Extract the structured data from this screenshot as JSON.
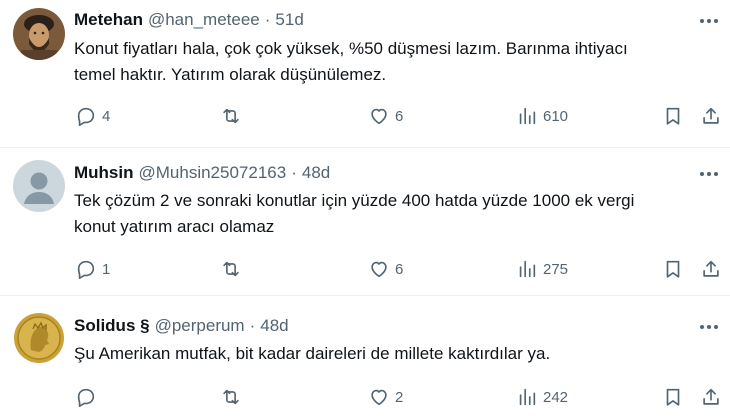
{
  "tweets": [
    {
      "name": "Metehan",
      "handle": "@han_meteee",
      "separator": "·",
      "time": "51d",
      "text_lines": [
        "Konut fiyatları hala, çok çok yüksek, %50 düşmesi lazım. Barınma ihtiyacı",
        "temel haktır. Yatırım olarak düşünülemez."
      ],
      "replies": "4",
      "retweets": "",
      "likes": "6",
      "views": "610",
      "avatar_icon": "historical-portrait-avatar"
    },
    {
      "name": "Muhsin",
      "handle": "@Muhsin25072163",
      "separator": "·",
      "time": "48d",
      "text_lines": [
        "Tek çözüm 2 ve sonraki konutlar için yüzde 400 hatda yüzde 1000 ek vergi",
        "konut yatırım aracı olamaz"
      ],
      "replies": "1",
      "retweets": "",
      "likes": "6",
      "views": "275",
      "avatar_icon": "default-user-avatar"
    },
    {
      "name": "Solidus §",
      "handle": "@perperum",
      "separator": "·",
      "time": "48d",
      "text_lines": [
        "Şu Amerikan mutfak, bit kadar daireleri de millete kaktırdılar ya."
      ],
      "replies": "",
      "retweets": "",
      "likes": "2",
      "views": "242",
      "avatar_icon": "gold-coin-avatar"
    }
  ],
  "colors": {
    "text_primary": "#0f1419",
    "text_secondary": "#536471",
    "divider": "#eff3f4"
  },
  "icons": [
    "reply-icon",
    "retweet-icon",
    "like-icon",
    "views-icon",
    "bookmark-icon",
    "share-icon",
    "more-icon"
  ]
}
